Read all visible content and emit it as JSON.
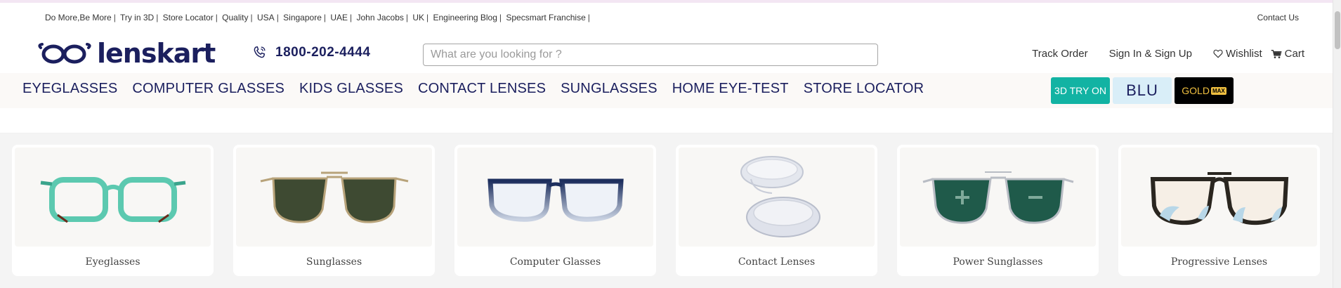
{
  "topbar": {
    "links": [
      "Do More,Be More",
      "Try in 3D",
      "Store Locator",
      "Quality",
      "USA",
      "Singapore",
      "UAE",
      "John Jacobs",
      "UK",
      "Engineering Blog",
      "Specsmart Franchise"
    ],
    "contact": "Contact Us"
  },
  "logo": {
    "text": "lenskart",
    "icon": "lenskart-glasses-logo-icon"
  },
  "phone": {
    "number": "1800-202-4444",
    "icon": "phone-icon"
  },
  "search": {
    "placeholder": "What are you looking for ?"
  },
  "header_links": {
    "track": "Track Order",
    "signin": "Sign In & Sign Up",
    "wishlist": "Wishlist",
    "cart": "Cart"
  },
  "nav": {
    "items": [
      "EYEGLASSES",
      "COMPUTER GLASSES",
      "KIDS GLASSES",
      "CONTACT LENSES",
      "SUNGLASSES",
      "HOME EYE-TEST",
      "STORE LOCATOR"
    ],
    "badges": {
      "try3d": "3D TRY ON",
      "blu": "BLU",
      "gold": "GOLD",
      "max": "MAX"
    }
  },
  "categories": [
    {
      "label": "Eyeglasses"
    },
    {
      "label": "Sunglasses"
    },
    {
      "label": "Computer Glasses"
    },
    {
      "label": "Contact Lenses"
    },
    {
      "label": "Power Sunglasses"
    },
    {
      "label": "Progressive Lenses"
    }
  ],
  "colors": {
    "brand": "#1b1f5e",
    "teal": "#12b3a3",
    "blu_bg": "#d9eef8",
    "gold": "#f0c040"
  }
}
